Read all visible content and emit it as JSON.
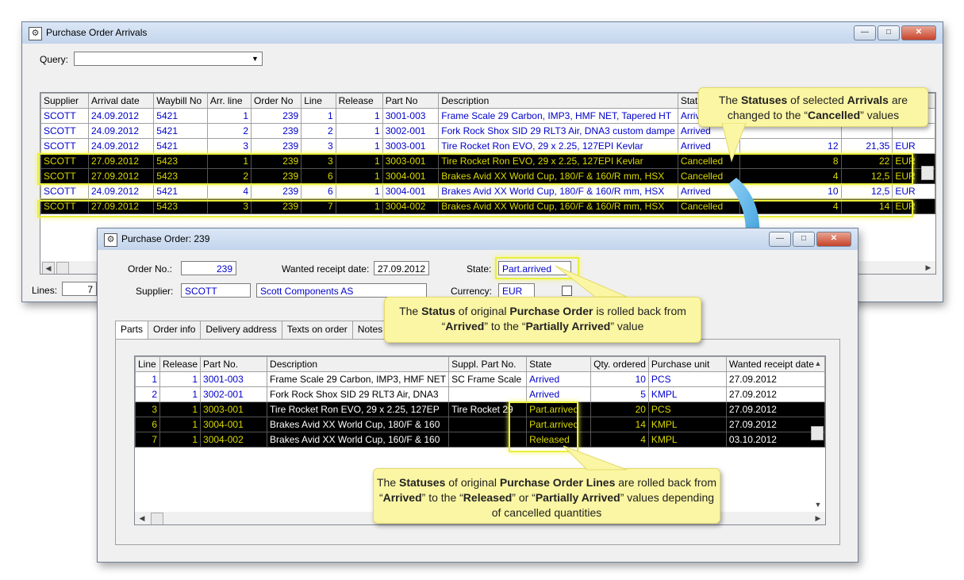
{
  "arrivals_window": {
    "title": "Purchase Order Arrivals",
    "query_label": "Query:",
    "query_value": "",
    "columns": [
      "Supplier",
      "Arrival date",
      "Waybill No",
      "Arr. line",
      "Order No",
      "Line",
      "Release",
      "Part No",
      "Description",
      "Stat"
    ],
    "rows": [
      {
        "supplier": "SCOTT",
        "date": "24.09.2012",
        "waybill": "5421",
        "arr_line": "1",
        "order": "239",
        "line": "1",
        "release": "1",
        "part": "3001-003",
        "desc": "Frame Scale 29 Carbon, IMP3, HMF NET, Tapered HT",
        "status": "Arrived",
        "qty": "",
        "price": "",
        "currency": ""
      },
      {
        "supplier": "SCOTT",
        "date": "24.09.2012",
        "waybill": "5421",
        "arr_line": "2",
        "order": "239",
        "line": "2",
        "release": "1",
        "part": "3002-001",
        "desc": "Fork Rock Shox SID 29 RLT3 Air, DNA3 custom dampe",
        "status": "Arrived",
        "qty": "",
        "price": "",
        "currency": ""
      },
      {
        "supplier": "SCOTT",
        "date": "24.09.2012",
        "waybill": "5421",
        "arr_line": "3",
        "order": "239",
        "line": "3",
        "release": "1",
        "part": "3003-001",
        "desc": "Tire Rocket Ron EVO, 29 x 2.25, 127EPI Kevlar",
        "status": "Arrived",
        "qty": "12",
        "price": "21,35",
        "currency": "EUR"
      },
      {
        "supplier": "SCOTT",
        "date": "27.09.2012",
        "waybill": "5423",
        "arr_line": "1",
        "order": "239",
        "line": "3",
        "release": "1",
        "part": "3003-001",
        "desc": "Tire Rocket Ron EVO, 29 x 2.25, 127EPI Kevlar",
        "status": "Cancelled",
        "qty": "8",
        "price": "22",
        "currency": "EUR",
        "selected": true
      },
      {
        "supplier": "SCOTT",
        "date": "27.09.2012",
        "waybill": "5423",
        "arr_line": "2",
        "order": "239",
        "line": "6",
        "release": "1",
        "part": "3004-001",
        "desc": "Brakes Avid XX World Cup, 180/F & 160/R mm, HSX",
        "status": "Cancelled",
        "qty": "4",
        "price": "12,5",
        "currency": "EUR",
        "selected": true
      },
      {
        "supplier": "SCOTT",
        "date": "24.09.2012",
        "waybill": "5421",
        "arr_line": "4",
        "order": "239",
        "line": "6",
        "release": "1",
        "part": "3004-001",
        "desc": "Brakes Avid XX World Cup, 180/F & 160/R mm, HSX",
        "status": "Arrived",
        "qty": "10",
        "price": "12,5",
        "currency": "EUR"
      },
      {
        "supplier": "SCOTT",
        "date": "27.09.2012",
        "waybill": "5423",
        "arr_line": "3",
        "order": "239",
        "line": "7",
        "release": "1",
        "part": "3004-002",
        "desc": "Brakes Avid XX World Cup, 160/F & 160/R mm, HSX",
        "status": "Cancelled",
        "qty": "4",
        "price": "14",
        "currency": "EUR",
        "selected": true
      }
    ],
    "lines_label": "Lines:",
    "lines_value": "7"
  },
  "order_window": {
    "title": "Purchase Order: 239",
    "order_no_label": "Order No.:",
    "order_no": "239",
    "wanted_label": "Wanted receipt date:",
    "wanted_date": "27.09.2012",
    "state_label": "State:",
    "state_value": "Part.arrived",
    "supplier_label": "Supplier:",
    "supplier_code": "SCOTT",
    "supplier_name": "Scott Components AS",
    "currency_label": "Currency:",
    "currency_value": "EUR",
    "tabs": [
      "Parts",
      "Order info",
      "Delivery address",
      "Texts on order",
      "Notes"
    ],
    "columns": [
      "Line",
      "Release",
      "Part No.",
      "Description",
      "Suppl. Part No.",
      "State",
      "Qty. ordered",
      "Purchase unit",
      "Wanted receipt date"
    ],
    "rows": [
      {
        "line": "1",
        "release": "1",
        "part": "3001-003",
        "desc": "Frame Scale 29 Carbon, IMP3, HMF NET",
        "supp": "SC Frame Scale",
        "state": "Arrived",
        "qty": "10",
        "unit": "PCS",
        "date": "27.09.2012"
      },
      {
        "line": "2",
        "release": "1",
        "part": "3002-001",
        "desc": "Fork Rock Shox SID 29 RLT3 Air, DNA3",
        "supp": "",
        "state": "Arrived",
        "qty": "5",
        "unit": "KMPL",
        "date": "27.09.2012"
      },
      {
        "line": "3",
        "release": "1",
        "part": "3003-001",
        "desc": "Tire Rocket Ron EVO, 29 x 2.25, 127EP",
        "supp": "Tire Rocket 29",
        "state": "Part.arrived",
        "qty": "20",
        "unit": "PCS",
        "date": "27.09.2012",
        "selected": true
      },
      {
        "line": "6",
        "release": "1",
        "part": "3004-001",
        "desc": "Brakes Avid XX World Cup, 180/F & 160",
        "supp": "",
        "state": "Part.arrived",
        "qty": "14",
        "unit": "KMPL",
        "date": "27.09.2012",
        "selected": true
      },
      {
        "line": "7",
        "release": "1",
        "part": "3004-002",
        "desc": "Brakes Avid XX World Cup, 160/F & 160",
        "supp": "",
        "state": "Released",
        "qty": "4",
        "unit": "KMPL",
        "date": "03.10.2012",
        "selected": true
      }
    ]
  },
  "callouts": {
    "arrivals": [
      "The ",
      "Statuses",
      " of selected ",
      "Arrivals",
      " are changed to the “",
      "Cancelled",
      "” values"
    ],
    "order": [
      "The ",
      "Status",
      " of original ",
      "Purchase Order",
      " is rolled back from “",
      "Arrived",
      "” to the “",
      "Partially Arrived",
      "” value"
    ],
    "lines": [
      "The ",
      "Statuses",
      " of original ",
      "Purchase Order Lines",
      " are rolled back from “",
      "Arrived",
      "” to the “",
      "Released",
      "” or “",
      "Partially Arrived",
      "” values depending of cancelled quantities"
    ]
  }
}
